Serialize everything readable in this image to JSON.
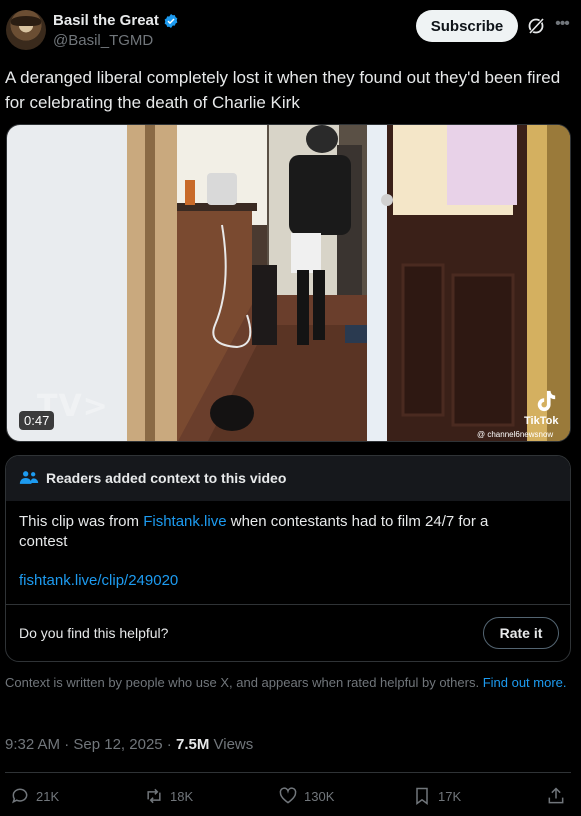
{
  "author": {
    "display_name": "Basil the Great",
    "handle": "@Basil_TGMD"
  },
  "header": {
    "subscribe_label": "Subscribe"
  },
  "tweet": {
    "text": "A deranged liberal completely lost it when they found out they'd been fired for celebrating the death of Charlie Kirk"
  },
  "video": {
    "duration": "0:47",
    "watermark": "TV>",
    "tiktok_label": "TikTok",
    "tiktok_user": "@ channel6newsnow"
  },
  "community_note": {
    "title": "Readers added context to this video",
    "body_prefix": "This clip was from ",
    "body_link": "Fishtank.live",
    "body_suffix": " when contestants had to film 24/7 for a contest",
    "url": "fishtank.live/clip/249020",
    "helpful_question": "Do you find this helpful?",
    "rate_label": "Rate it"
  },
  "context_info": {
    "text": "Context is written by people who use X, and appears when rated helpful by others. ",
    "link": "Find out more."
  },
  "meta": {
    "time": "9:32 AM",
    "separator": " · ",
    "date": "Sep 12, 2025",
    "views": "7.5M",
    "views_label": " Views"
  },
  "actions": {
    "replies": "21K",
    "reposts": "18K",
    "likes": "130K",
    "bookmarks": "17K"
  },
  "colors": {
    "background": "#000000",
    "text": "#e7e9ea",
    "muted": "#71767b",
    "accent": "#1d9bf0",
    "verified": "#1d9bf0"
  },
  "icons": [
    "avatar",
    "verified-badge-icon",
    "grok-icon",
    "more-icon",
    "community-notes-icon",
    "tiktok-icon",
    "reply-icon",
    "repost-icon",
    "like-icon",
    "bookmark-icon",
    "share-icon"
  ]
}
